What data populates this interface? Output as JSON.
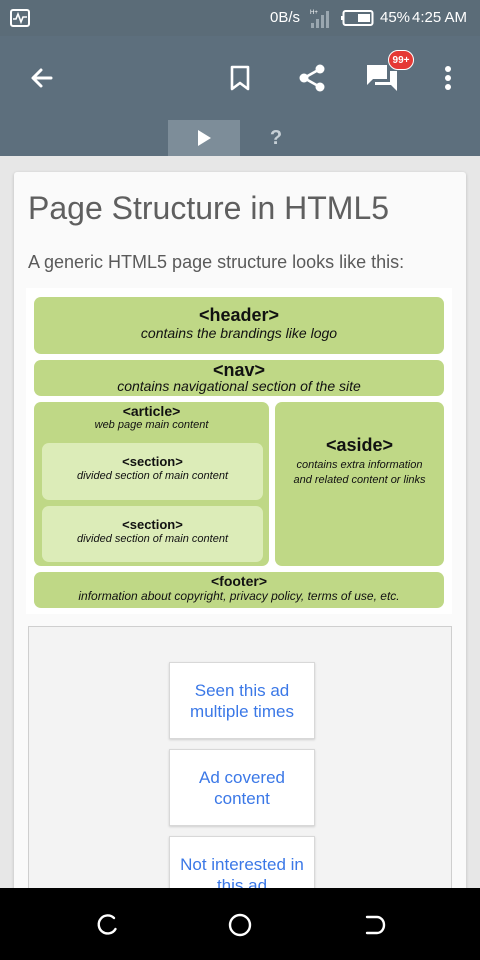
{
  "status_bar": {
    "net_speed": "0B/s",
    "battery": "45%",
    "time": "4:25 AM",
    "icons": [
      "activity-monitor-icon",
      "signal-icon",
      "battery-icon"
    ]
  },
  "toolbar": {
    "icons": [
      "back-arrow-icon",
      "bookmark-icon",
      "share-icon",
      "comments-icon",
      "more-vert-icon"
    ],
    "comment_badge": "99+"
  },
  "tabs": {
    "play_icon": "play-icon",
    "help_label": "?"
  },
  "article": {
    "title": "Page Structure in HTML5",
    "intro": "A generic HTML5 page structure looks like this:"
  },
  "diagram": {
    "header": {
      "tag": "<header>",
      "desc": "contains the brandings like logo"
    },
    "nav": {
      "tag": "<nav>",
      "desc": "contains navigational section of the site"
    },
    "article": {
      "tag": "<article>",
      "desc": "web page main content"
    },
    "section1": {
      "tag": "<section>",
      "desc": "divided section of main content"
    },
    "section2": {
      "tag": "<section>",
      "desc": "divided section of main content"
    },
    "aside": {
      "tag": "<aside>",
      "desc_line1": "contains extra information",
      "desc_line2": "and related content or links"
    },
    "footer": {
      "tag": "<footer>",
      "desc": "information about copyright, privacy policy, terms of use, etc."
    }
  },
  "ad_feedback": {
    "options": [
      "Seen this ad multiple times",
      "Ad covered content",
      "Not interested in this ad"
    ],
    "accent": "#3b78e7"
  },
  "nav_bar": {
    "icons": [
      "recents-icon",
      "home-icon",
      "back-icon"
    ]
  }
}
